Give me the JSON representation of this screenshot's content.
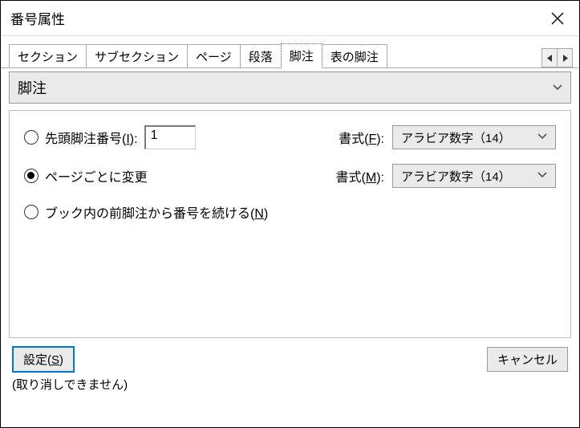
{
  "title": "番号属性",
  "tabs": {
    "t0": "セクション",
    "t1": "サブセクション",
    "t2": "ページ",
    "t3": "段落",
    "t4": "脚注",
    "t5": "表の脚注"
  },
  "section_dd": "脚注",
  "opt": {
    "first_label_a": "先頭脚注番号(",
    "first_key": "I",
    "first_label_b": "):",
    "first_value": "1",
    "perpage": "ページごとに変更",
    "continue_a": "ブック内の前脚注から番号を続ける(",
    "continue_key": "N",
    "continue_b": ")"
  },
  "fmt": {
    "label_f_a": "書式(",
    "label_f_key": "F",
    "label_f_b": "):",
    "label_m_a": "書式(",
    "label_m_key": "M",
    "label_m_b": "):",
    "value": "アラビア数字（14）"
  },
  "buttons": {
    "set_a": "設定(",
    "set_key": "S",
    "set_b": ")",
    "cancel": "キャンセル"
  },
  "note": "(取り消しできません)"
}
